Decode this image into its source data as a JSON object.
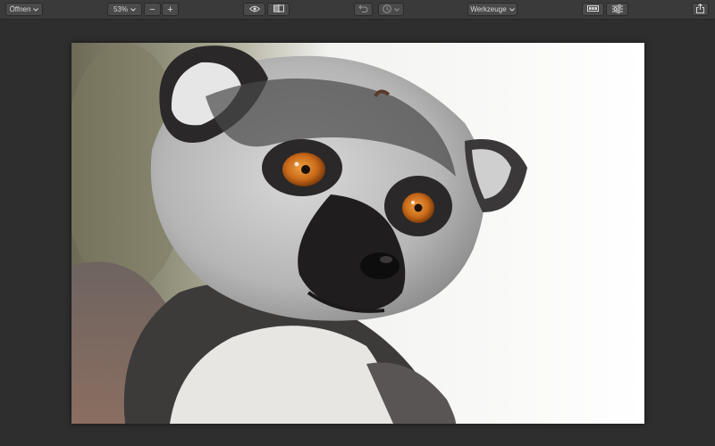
{
  "toolbar": {
    "open_label": "Öffnen",
    "zoom_value": "53%",
    "zoom_out_label": "−",
    "zoom_in_label": "+",
    "preview_icon": "eye-icon",
    "compare_icon": "split-compare-icon",
    "undo_icon": "undo-icon",
    "history_icon": "history-clock-icon",
    "tools_label": "Werkzeuge",
    "filmstrip_icon": "filmstrip-icon",
    "adjustments_icon": "sliders-icon",
    "share_icon": "share-icon"
  },
  "image": {
    "subject": "ring-tailed lemur portrait",
    "background_color": "#ffffff"
  },
  "colors": {
    "app_background": "#2e2e2e",
    "toolbar_background": "#3a3a3a",
    "button_background": "#4a4a4a",
    "eye_color": "#c96a1a"
  }
}
